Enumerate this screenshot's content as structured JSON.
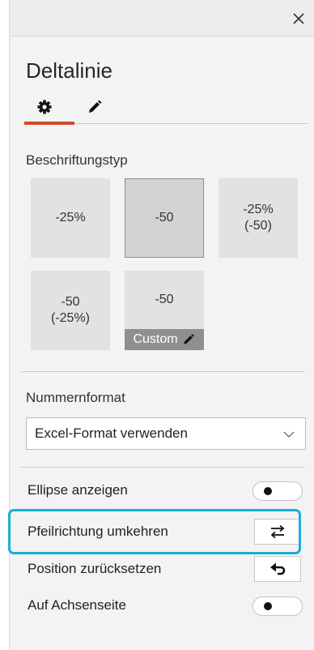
{
  "panel": {
    "title": "Deltalinie"
  },
  "tabs": [
    {
      "name": "settings",
      "icon": "gear-icon",
      "active": true
    },
    {
      "name": "edit",
      "icon": "pencil-icon",
      "active": false
    }
  ],
  "label_type": {
    "heading": "Beschriftungstyp",
    "tiles": [
      {
        "line1": "-25%",
        "line2": ""
      },
      {
        "line1": "-50",
        "line2": ""
      },
      {
        "line1": "-25%",
        "line2": "(-50)"
      },
      {
        "line1": "-50",
        "line2": "(-25%)"
      },
      {
        "line1": "-50",
        "line2": "",
        "custom_label": "Custom"
      }
    ],
    "selected_index": 1
  },
  "number_format": {
    "heading": "Nummernformat",
    "selected": "Excel-Format verwenden"
  },
  "options": {
    "ellipse_label": "Ellipse anzeigen",
    "ellipse_on": false,
    "reverse_arrow_label": "Pfeilrichtung umkehren",
    "reset_position_label": "Position zurücksetzen",
    "axis_side_label": "Auf Achsenseite",
    "axis_side_on": false
  },
  "colors": {
    "accent": "#d04a2a",
    "highlight": "#1aaed8"
  }
}
